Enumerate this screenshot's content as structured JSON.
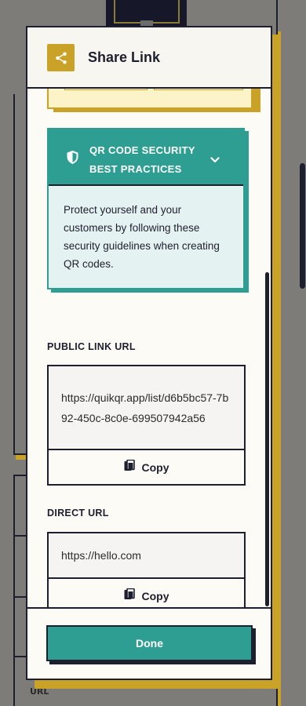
{
  "modal": {
    "title": "Share Link",
    "share_icon": "share-icon"
  },
  "qr_security": {
    "title_line1": "QR CODE SECURITY",
    "title_line2": "BEST PRACTICES",
    "icon": "shield-icon",
    "chevron": "chevron-down-icon",
    "description": "Protect yourself and your customers by following these security guidelines when creating QR codes.",
    "expanded": true
  },
  "public_link": {
    "label": "PUBLIC LINK URL",
    "url": "https://quikqr.app/list/d6b5bc57-7b92-450c-8c0e-699507942a56",
    "copy_label": "Copy",
    "copy_icon": "copy-icon"
  },
  "direct_link": {
    "label": "DIRECT URL",
    "url": "https://hello.com",
    "copy_label": "Copy",
    "copy_icon": "copy-icon"
  },
  "footer": {
    "done_label": "Done"
  },
  "background": {
    "partial_label": "URL"
  },
  "colors": {
    "accent_teal": "#2e9e93",
    "accent_gold": "#c9a227",
    "navy": "#1e1f2e",
    "panel_bg": "#fdfbf5",
    "info_bg": "#e5f2f2"
  }
}
